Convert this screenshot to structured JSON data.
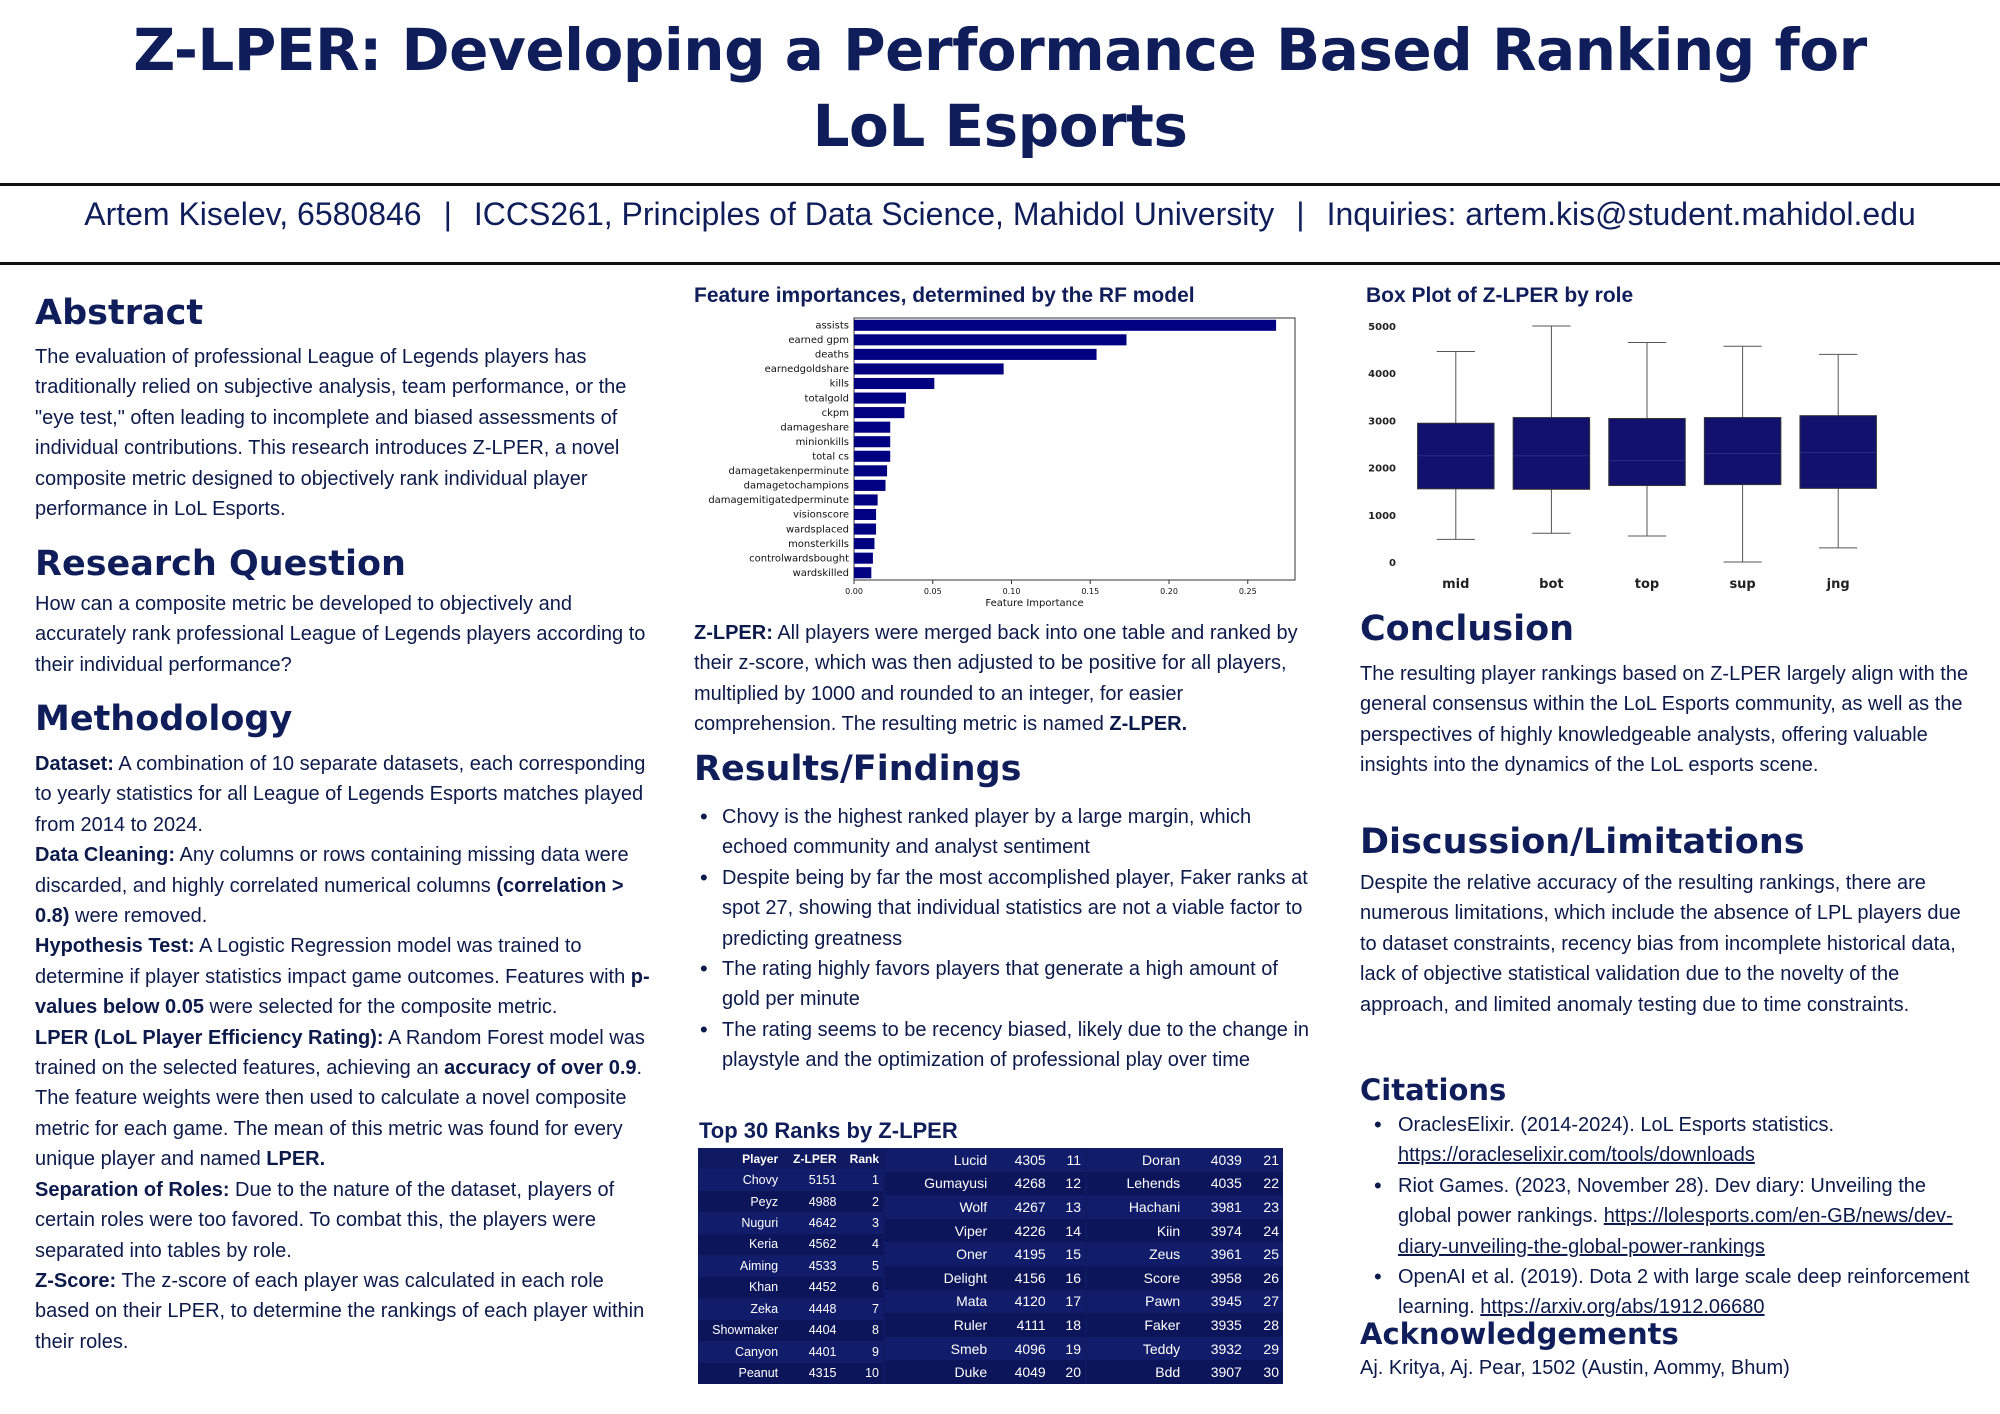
{
  "header": {
    "title_line1": "Z-LPER: Developing a Performance Based Ranking for",
    "title_line2": "LoL Esports",
    "author": "Artem Kiselev, 6580846",
    "course": "ICCS261, Principles of Data Science, Mahidol University",
    "inquiries": "Inquiries: artem.kis@student.mahidol.edu",
    "separator": "|"
  },
  "abstract": {
    "heading": "Abstract",
    "text": "The evaluation of professional League of Legends players has traditionally relied on subjective analysis, team performance, or the \"eye test,\" often leading to incomplete and biased assessments of individual contributions. This research introduces Z-LPER, a novel composite metric designed to objectively rank individual player performance in LoL Esports."
  },
  "research_question": {
    "heading": "Research Question",
    "text": "How can a composite metric be developed to objectively and accurately rank professional League of Legends players according to their individual performance?"
  },
  "methodology": {
    "heading": "Methodology",
    "dataset_label": "Dataset:",
    "dataset_text": " A combination of 10 separate datasets, each corresponding to yearly statistics for all League of Legends Esports matches played from 2014 to 2024.",
    "cleaning_label": "Data Cleaning:",
    "cleaning_text1": " Any columns or rows containing missing data were discarded, and highly correlated numerical columns ",
    "cleaning_bold": "(correlation > 0.8)",
    "cleaning_text2": " were removed.",
    "hypothesis_label": "Hypothesis Test:",
    "hypothesis_text1": " A Logistic Regression model was trained to determine if player statistics impact game outcomes. Features with ",
    "hypothesis_bold": "p-values below 0.05",
    "hypothesis_text2": " were selected for the composite metric.",
    "lper_label": "LPER (LoL Player Efficiency Rating):",
    "lper_text1": " A Random Forest model was trained on the selected features, achieving an ",
    "lper_bold": "accuracy of over 0.9",
    "lper_text2": ". The feature weights were then used to calculate a novel composite metric for each game. The mean of this metric was found for every unique player and named ",
    "lper_bold2": "LPER.",
    "roles_label": "Separation of Roles:",
    "roles_text": " Due to the nature of the dataset, players of certain roles were too favored. To combat this, the players were separated into tables by role.",
    "zscore_label": "Z-Score:",
    "zscore_text": " The z-score of each player was calculated in each role based on their LPER, to determine the rankings of each player within their roles."
  },
  "feature_chart_title": "Feature importances, determined by the RF model",
  "zlper": {
    "label": "Z-LPER:",
    "text1": " All players were merged back into one table and ranked by their z-score, which was then adjusted to be positive for all players, multiplied by 1000 and rounded to an integer, for easier comprehension. The resulting metric is named ",
    "bold": "Z-LPER."
  },
  "results": {
    "heading": "Results/Findings",
    "items": [
      "Chovy is the highest ranked player by a large margin, which echoed community and analyst sentiment",
      "Despite being by far the most accomplished player, Faker ranks at spot 27, showing that individual statistics are not a viable factor to predicting greatness",
      "The rating highly favors players that generate a high amount of gold per minute",
      "The rating seems to be recency biased, likely due to the change in playstyle and the optimization of professional play over time"
    ]
  },
  "ranks": {
    "title": "Top 30 Ranks by Z-LPER",
    "headers": [
      "Player",
      "Z-LPER",
      "Rank"
    ],
    "rows": [
      [
        "Chovy",
        "5151",
        "1"
      ],
      [
        "Peyz",
        "4988",
        "2"
      ],
      [
        "Nuguri",
        "4642",
        "3"
      ],
      [
        "Keria",
        "4562",
        "4"
      ],
      [
        "Aiming",
        "4533",
        "5"
      ],
      [
        "Khan",
        "4452",
        "6"
      ],
      [
        "Zeka",
        "4448",
        "7"
      ],
      [
        "Showmaker",
        "4404",
        "8"
      ],
      [
        "Canyon",
        "4401",
        "9"
      ],
      [
        "Peanut",
        "4315",
        "10"
      ],
      [
        "Lucid",
        "4305",
        "11"
      ],
      [
        "Gumayusi",
        "4268",
        "12"
      ],
      [
        "Wolf",
        "4267",
        "13"
      ],
      [
        "Viper",
        "4226",
        "14"
      ],
      [
        "Oner",
        "4195",
        "15"
      ],
      [
        "Delight",
        "4156",
        "16"
      ],
      [
        "Mata",
        "4120",
        "17"
      ],
      [
        "Ruler",
        "4111",
        "18"
      ],
      [
        "Smeb",
        "4096",
        "19"
      ],
      [
        "Duke",
        "4049",
        "20"
      ],
      [
        "Doran",
        "4039",
        "21"
      ],
      [
        "Lehends",
        "4035",
        "22"
      ],
      [
        "Hachani",
        "3981",
        "23"
      ],
      [
        "Kiin",
        "3974",
        "24"
      ],
      [
        "Zeus",
        "3961",
        "25"
      ],
      [
        "Score",
        "3958",
        "26"
      ],
      [
        "Pawn",
        "3945",
        "27"
      ],
      [
        "Faker",
        "3935",
        "28"
      ],
      [
        "Teddy",
        "3932",
        "29"
      ],
      [
        "Bdd",
        "3907",
        "30"
      ]
    ]
  },
  "box_chart_title": "Box Plot of Z-LPER by role",
  "conclusion": {
    "heading": "Conclusion",
    "text": "The resulting player rankings based on Z-LPER largely align with the general consensus within the LoL Esports community, as well as the perspectives of highly knowledgeable analysts, offering valuable insights into the dynamics of the LoL esports scene."
  },
  "discussion": {
    "heading": "Discussion/Limitations",
    "text": "Despite the relative accuracy of the resulting rankings, there are numerous limitations, which include the absence of LPL players due to dataset constraints, recency bias from incomplete historical data, lack of objective statistical validation due to the novelty of the approach, and limited anomaly testing due to time constraints."
  },
  "citations": {
    "heading": "Citations",
    "items": [
      {
        "text": "OraclesElixir. (2014-2024). LoL Esports statistics. ",
        "link": "https://oracleselixir.com/tools/downloads"
      },
      {
        "text": "Riot Games. (2023, November 28). Dev diary: Unveiling the global power rankings. ",
        "link": "https://lolesports.com/en-GB/news/dev-diary-unveiling-the-global-power-rankings"
      },
      {
        "text": "OpenAI et al. (2019). Dota 2 with large scale deep reinforcement learning. ",
        "link": "https://arxiv.org/abs/1912.06680"
      }
    ]
  },
  "acknowledgements": {
    "heading": "Acknowledgements",
    "text": "Aj. Kritya, Aj. Pear, 1502 (Austin, Aommy, Bhum)"
  },
  "chart_data": [
    {
      "type": "bar",
      "orientation": "horizontal",
      "categories": [
        "assists",
        "earned gpm",
        "deaths",
        "earnedgoldshare",
        "kills",
        "totalgold",
        "ckpm",
        "damageshare",
        "minionkills",
        "total cs",
        "damagetakenperminute",
        "damagetochampions",
        "damagemitigatedperminute",
        "visionscore",
        "wardsplaced",
        "monsterkills",
        "controlwardsbought",
        "wardskilled"
      ],
      "values": [
        0.268,
        0.173,
        0.154,
        0.095,
        0.051,
        0.033,
        0.032,
        0.023,
        0.023,
        0.023,
        0.021,
        0.02,
        0.015,
        0.014,
        0.014,
        0.013,
        0.012,
        0.011
      ],
      "xlabel": "Feature Importance",
      "xticks": [
        "0.00",
        "0.05",
        "0.10",
        "0.15",
        "0.20",
        "0.25"
      ],
      "xlim": [
        0,
        0.28
      ],
      "color": "#000080"
    },
    {
      "type": "box",
      "categories": [
        "mid",
        "bot",
        "top",
        "sup",
        "jng"
      ],
      "series": [
        {
          "label": "mid",
          "min": 480,
          "q1": 1550,
          "median": 2250,
          "q3": 2940,
          "max": 4460
        },
        {
          "label": "bot",
          "min": 610,
          "q1": 1540,
          "median": 2250,
          "q3": 3060,
          "max": 5000
        },
        {
          "label": "top",
          "min": 550,
          "q1": 1620,
          "median": 2150,
          "q3": 3040,
          "max": 4650
        },
        {
          "label": "sup",
          "min": 0,
          "q1": 1640,
          "median": 2300,
          "q3": 3060,
          "max": 4570
        },
        {
          "label": "jng",
          "min": 300,
          "q1": 1560,
          "median": 2320,
          "q3": 3100,
          "max": 4400
        }
      ],
      "yticks": [
        "0",
        "1000",
        "2000",
        "3000",
        "4000",
        "5000"
      ],
      "ylim": [
        0,
        5000
      ],
      "color": "#12126e"
    }
  ]
}
